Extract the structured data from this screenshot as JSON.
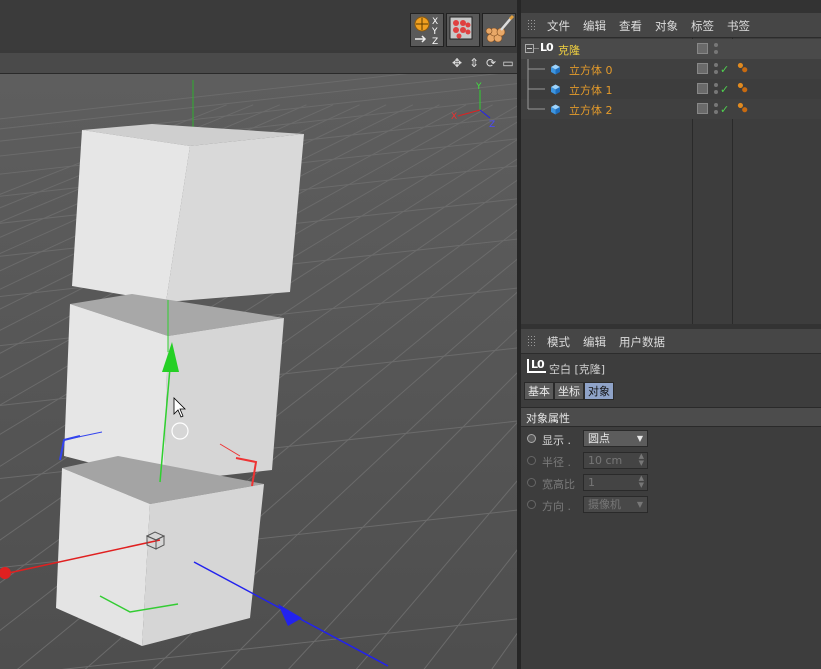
{
  "toolbar": {
    "buttons": [
      {
        "name": "coordinate-system-button",
        "icon": "xyz-axis-icon"
      },
      {
        "name": "render-region-button",
        "icon": "render-grid-icon"
      },
      {
        "name": "material-brush-button",
        "icon": "paint-brush-icon"
      }
    ],
    "axis_letters": [
      "X",
      "Y",
      "Z"
    ]
  },
  "viewport": {
    "nav_icons": [
      "move-view-icon",
      "zoom-view-icon",
      "rotate-view-icon",
      "maximize-view-icon"
    ],
    "nav_glyphs": [
      "✥",
      "⇕",
      "⟳",
      "▭"
    ],
    "gizmo_labels": {
      "y": "Y",
      "x": "X",
      "z": "Z"
    },
    "colors": {
      "x": "#e03030",
      "y": "#30d030",
      "z": "#2d2df0",
      "cube": "#d8d8d8"
    }
  },
  "object_manager": {
    "menu": [
      "文件",
      "编辑",
      "查看",
      "对象",
      "标签",
      "书签"
    ],
    "root": {
      "label": "克隆",
      "icon": "null-object-icon",
      "icon_text": "L0"
    },
    "children": [
      {
        "label": "立方体 0"
      },
      {
        "label": "立方体 1"
      },
      {
        "label": "立方体 2"
      }
    ],
    "colors": {
      "root": "#f0d040",
      "child": "#e39a2b"
    }
  },
  "attribute_manager": {
    "menu": [
      "模式",
      "编辑",
      "用户数据"
    ],
    "object_title": "空白 [克隆]",
    "icon_text": "L0",
    "tabs": [
      {
        "label": "基本",
        "active": false
      },
      {
        "label": "坐标",
        "active": false
      },
      {
        "label": "对象",
        "active": true
      }
    ],
    "section": "对象属性",
    "fields": [
      {
        "label": "显示",
        "value": "圆点",
        "enabled": true,
        "type": "dropdown"
      },
      {
        "label": "半径",
        "value": "10 cm",
        "enabled": false,
        "type": "stepper"
      },
      {
        "label": "宽高比",
        "value": "1",
        "enabled": false,
        "type": "stepper"
      },
      {
        "label": "方向",
        "value": "摄像机",
        "enabled": false,
        "type": "dropdown"
      }
    ]
  }
}
